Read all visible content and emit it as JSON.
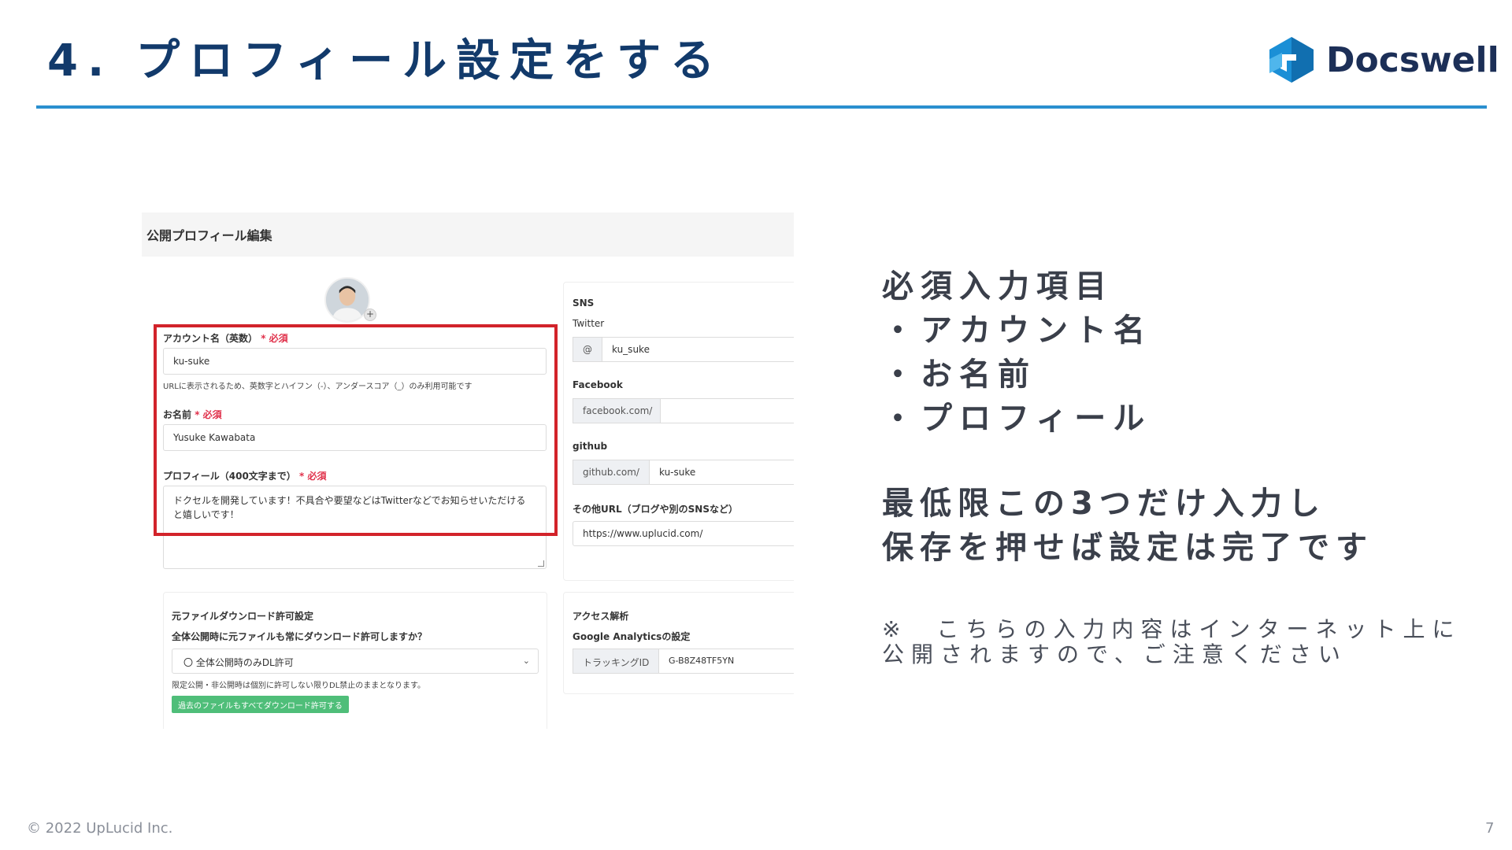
{
  "slide": {
    "title_num": "4.",
    "title_text": "プロフィール設定をする",
    "logo_text": "Docswell",
    "copyright": "© 2022 UpLucid Inc.",
    "page_number": "7",
    "colors": {
      "title": "#123a6b",
      "rule": "#2a8fcf",
      "highlight": "#d2232a",
      "button": "#4fbe79"
    }
  },
  "screenshot": {
    "heading": "公開プロフィール編集",
    "avatar_plus": "+",
    "account": {
      "label": "アカウント名（英数）",
      "required": "* 必須",
      "value": "ku-suke",
      "hint": "URLに表示されるため、英数字とハイフン（-）、アンダースコア（_）のみ利用可能です"
    },
    "name": {
      "label": "お名前",
      "required": "* 必須",
      "value": "Yusuke Kawabata"
    },
    "profile": {
      "label": "プロフィール（400文字まで）",
      "required": "* 必須",
      "value_line1": "ドクセルを開発しています！不具合や要望などはTwitterなどでお知らせいただける",
      "value_line2": "と嬉しいです！"
    },
    "sns": {
      "heading": "SNS",
      "twitter_label": "Twitter",
      "twitter_prefix": "@",
      "twitter_value": "ku_suke",
      "facebook_label": "Facebook",
      "facebook_prefix": "facebook.com/",
      "facebook_value": "",
      "github_label": "github",
      "github_prefix": "github.com/",
      "github_value": "ku-suke",
      "other_label": "その他URL（ブログや別のSNSなど）",
      "other_value": "https://www.uplucid.com/"
    },
    "download": {
      "heading": "元ファイルダウンロード許可設定",
      "question": "全体公開時に元ファイルも常にダウンロード許可しますか？",
      "selected": "〇 全体公開時のみDL許可",
      "note": "限定公開・非公開時は個別に許可しない限りDL禁止のままとなります。",
      "button": "過去のファイルもすべてダウンロード許可する"
    },
    "analytics": {
      "heading": "アクセス解析",
      "sub": "Google Analyticsの設定",
      "prefix": "トラッキングID",
      "value": "G-B8Z48TF5YN"
    }
  },
  "right": {
    "required_heading": "必須入力項目",
    "items": [
      "・アカウント名",
      "・お名前",
      "・プロフィール"
    ],
    "summary_line1": "最低限この3つだけ入力し",
    "summary_line2": "保存を押せば設定は完了です",
    "note_line1": "※　こちらの入力内容はインターネット上に",
    "note_line2": "公開されますので、ご注意ください"
  }
}
